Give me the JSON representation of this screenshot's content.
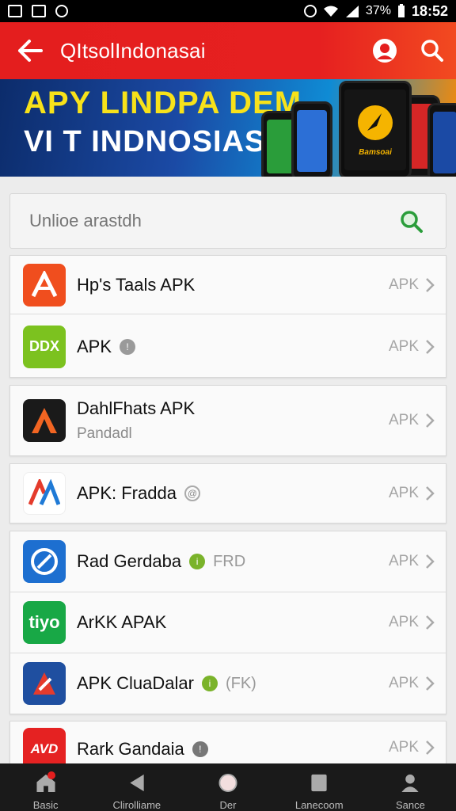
{
  "status_bar": {
    "battery": "37%",
    "time": "18:52"
  },
  "app_bar": {
    "title": "QItsolIndonasai",
    "back_icon": "arrow-left-icon",
    "account_icon": "account-icon",
    "search_icon": "search-icon"
  },
  "banner": {
    "line1": "APY LINDPA DEM",
    "line2": "VI T INDNOSIAS",
    "phone_label": "Bamsoai"
  },
  "search": {
    "placeholder": "Unlioe arastdh"
  },
  "apps": [
    {
      "name": "Hp's Taals APK",
      "sub": "",
      "tag": "",
      "badge": "",
      "right_label": "APK",
      "icon_text": "A",
      "icon_color": "#f04e1e"
    },
    {
      "name": "APK",
      "sub": "",
      "tag": "",
      "badge": "!",
      "right_label": "APK",
      "icon_text": "DDX",
      "icon_color": "#7cc21f"
    },
    {
      "name": "DahlFhats APK",
      "sub": "Pandadl",
      "tag": "",
      "badge": "",
      "right_label": "APK",
      "icon_text": "A",
      "icon_color": "#1a1a1a"
    },
    {
      "name": "APK: Fradda",
      "sub": "",
      "tag": "",
      "badge": "@",
      "right_label": "APK",
      "icon_text": "A",
      "icon_color": "#ffffff"
    },
    {
      "name": "Rad Gerdaba",
      "sub": "",
      "tag": "FRD",
      "badge": "i",
      "right_label": "APK",
      "icon_text": "",
      "icon_color": "#1d6fd0"
    },
    {
      "name": "ArKK APAK",
      "sub": "",
      "tag": "",
      "badge": "",
      "right_label": "APK",
      "icon_text": "tiyo",
      "icon_color": "#18a846"
    },
    {
      "name": "APK CluaDalar",
      "sub": "",
      "tag": "(FK)",
      "badge": "i",
      "right_label": "APK",
      "icon_text": "",
      "icon_color": "#1f4fa0"
    },
    {
      "name": "Rark Gandaia",
      "sub": "",
      "tag": "",
      "badge": "!",
      "right_label": "APK",
      "icon_text": "AVD",
      "icon_color": "#e52222"
    }
  ],
  "bottom_nav": [
    {
      "label": "Basic",
      "icon": "home-icon"
    },
    {
      "label": "Clirolliame",
      "icon": "back-triangle-icon"
    },
    {
      "label": "Der",
      "icon": "circle-icon"
    },
    {
      "label": "Lanecoom",
      "icon": "square-icon"
    },
    {
      "label": "Sance",
      "icon": "person-icon"
    }
  ],
  "colors": {
    "primary": "#e41e1e",
    "status_bar": "#000000",
    "nav_bar": "#1a1a1a"
  }
}
